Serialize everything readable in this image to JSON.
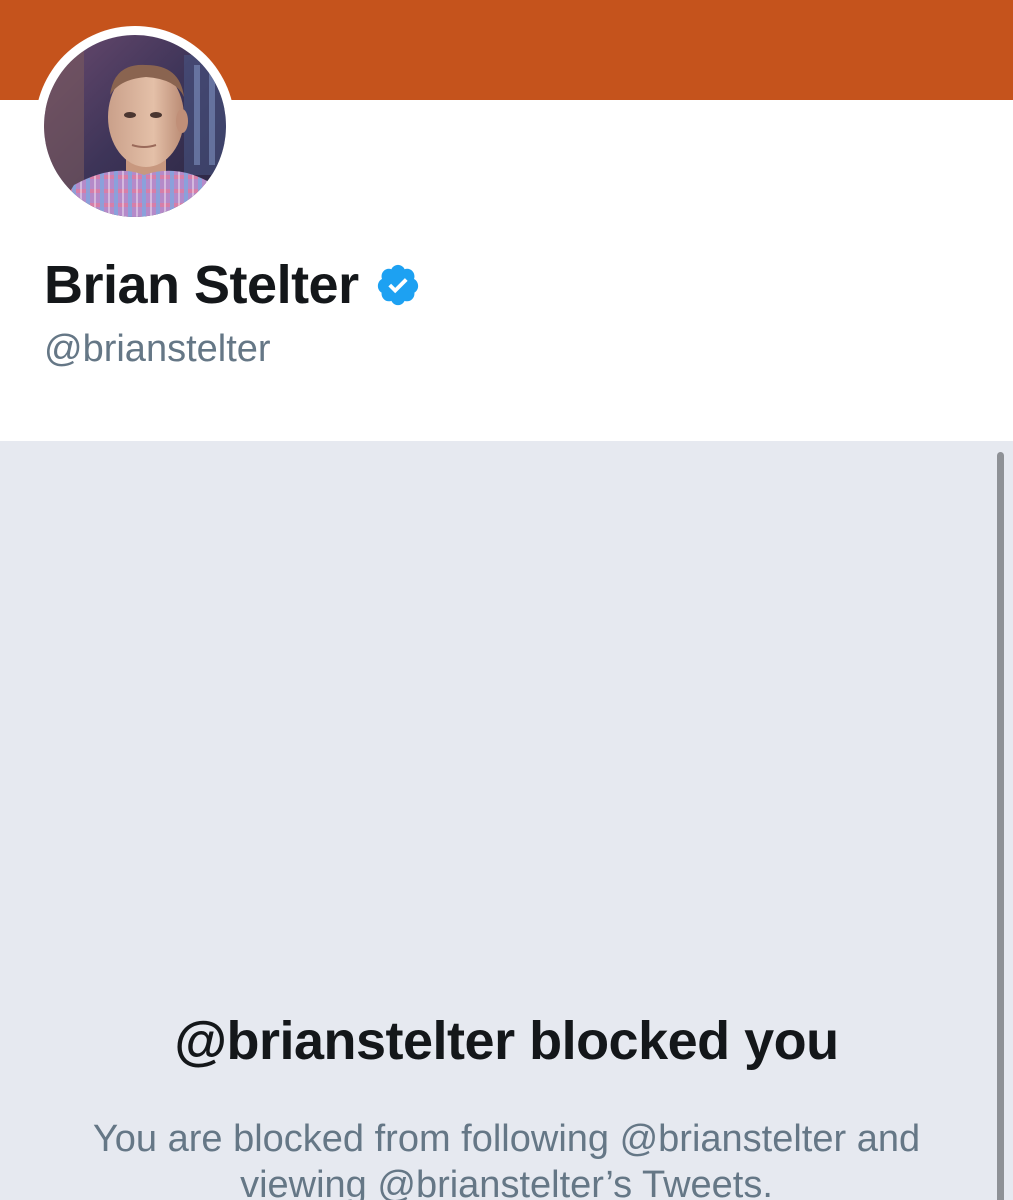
{
  "colors": {
    "banner": "#c5531c",
    "blocked_background": "#e6e9f0",
    "text_primary": "#14171a",
    "text_secondary": "#657786",
    "verified_blue": "#1da1f2"
  },
  "profile": {
    "display_name": "Brian Stelter",
    "handle": "@brianstelter",
    "verified_icon": "verified-badge-icon",
    "avatar": "profile-photo"
  },
  "blocked": {
    "title": "@brianstelter blocked you",
    "description": "You are blocked from following @brianstelter and viewing @brianstelter’s Tweets."
  }
}
